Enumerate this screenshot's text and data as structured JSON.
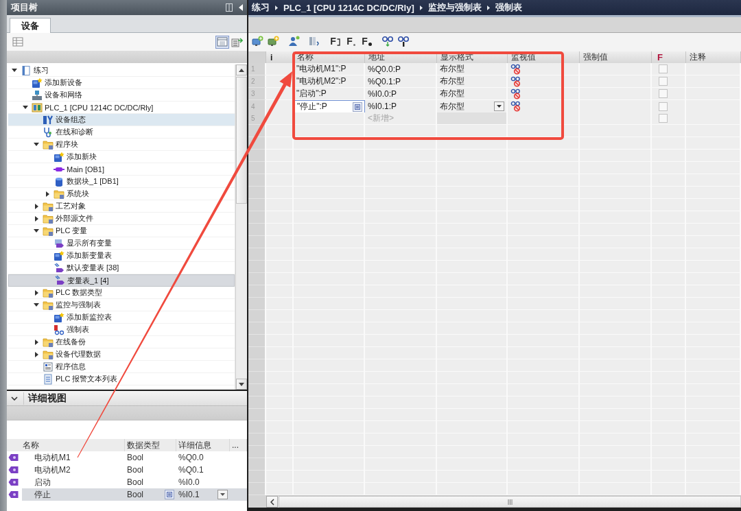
{
  "project_tree": {
    "title": "项目树",
    "tabs": [
      {
        "label": "设备",
        "selected": true
      }
    ],
    "items": [
      {
        "label": "练习",
        "kind": "project",
        "expanded": true,
        "selected": false,
        "highlighted": false,
        "children": [
          {
            "label": "添加新设备",
            "kind": "add",
            "selected": false,
            "highlighted": false
          },
          {
            "label": "设备和网络",
            "kind": "network",
            "selected": false,
            "highlighted": false
          },
          {
            "label": "PLC_1 [CPU 1214C DC/DC/Rly]",
            "kind": "plc",
            "expanded": true,
            "selected": false,
            "highlighted": false,
            "children": [
              {
                "label": "设备组态",
                "kind": "config",
                "selected": false,
                "highlighted": true
              },
              {
                "label": "在线和诊断",
                "kind": "diag",
                "selected": false,
                "highlighted": false
              },
              {
                "label": "程序块",
                "kind": "folder",
                "expanded": true,
                "selected": false,
                "highlighted": false,
                "children": [
                  {
                    "label": "添加新块",
                    "kind": "add",
                    "selected": false,
                    "highlighted": false
                  },
                  {
                    "label": "Main [OB1]",
                    "kind": "ob",
                    "selected": false,
                    "highlighted": false
                  },
                  {
                    "label": "数据块_1 [DB1]",
                    "kind": "db",
                    "selected": false,
                    "highlighted": false
                  },
                  {
                    "label": "系统块",
                    "kind": "folder",
                    "expanded": false,
                    "selected": false,
                    "highlighted": false
                  }
                ]
              },
              {
                "label": "工艺对象",
                "kind": "folder",
                "expanded": false,
                "selected": false,
                "highlighted": false
              },
              {
                "label": "外部源文件",
                "kind": "folder",
                "expanded": false,
                "selected": false,
                "highlighted": false
              },
              {
                "label": "PLC 变量",
                "kind": "folder",
                "expanded": true,
                "selected": false,
                "highlighted": false,
                "children": [
                  {
                    "label": "显示所有变量",
                    "kind": "alltags",
                    "selected": false,
                    "highlighted": false
                  },
                  {
                    "label": "添加新变量表",
                    "kind": "add",
                    "selected": false,
                    "highlighted": false
                  },
                  {
                    "label": "默认变量表 [38]",
                    "kind": "tagtable",
                    "selected": false,
                    "highlighted": false
                  },
                  {
                    "label": "变量表_1 [4]",
                    "kind": "tagtable",
                    "selected": true,
                    "highlighted": false
                  }
                ]
              },
              {
                "label": "PLC 数据类型",
                "kind": "folder",
                "expanded": false,
                "selected": false,
                "highlighted": false
              },
              {
                "label": "监控与强制表",
                "kind": "folder",
                "expanded": true,
                "selected": false,
                "highlighted": false,
                "children": [
                  {
                    "label": "添加新监控表",
                    "kind": "add",
                    "selected": false,
                    "highlighted": false
                  },
                  {
                    "label": "强制表",
                    "kind": "forcetable",
                    "selected": false,
                    "highlighted": false
                  }
                ]
              },
              {
                "label": "在线备份",
                "kind": "folder",
                "expanded": false,
                "selected": false,
                "highlighted": false
              },
              {
                "label": "设备代理数据",
                "kind": "folder",
                "expanded": false,
                "selected": false,
                "highlighted": false
              },
              {
                "label": "程序信息",
                "kind": "info",
                "selected": false,
                "highlighted": false
              },
              {
                "label": "PLC 报警文本列表",
                "kind": "textlist",
                "selected": false,
                "highlighted": false
              }
            ]
          }
        ]
      }
    ]
  },
  "details_view": {
    "title": "详细视图",
    "expanded": true,
    "columns": [
      "名称",
      "数据类型",
      "详细信息",
      "..."
    ],
    "rows": [
      {
        "name": "电动机M1",
        "data_type": "Bool",
        "detail": "%Q0.0",
        "selected": false
      },
      {
        "name": "电动机M2",
        "data_type": "Bool",
        "detail": "%Q0.1",
        "selected": false
      },
      {
        "name": "启动",
        "data_type": "Bool",
        "detail": "%I0.0",
        "selected": false
      },
      {
        "name": "停止",
        "data_type": "Bool",
        "detail": "%I0.1",
        "selected": true
      }
    ]
  },
  "editor": {
    "breadcrumb": [
      "练习",
      "PLC_1 [CPU 1214C DC/DC/Rly]",
      "监控与强制表",
      "强制表"
    ],
    "toolbar": [
      {
        "kind": "insert"
      },
      {
        "kind": "append"
      },
      {
        "kind": "users"
      },
      {
        "kind": "sheet"
      },
      {
        "kind": "forceall",
        "text": "F"
      },
      {
        "kind": "forcestop",
        "text": "F"
      },
      {
        "kind": "forceone",
        "text": "F"
      },
      {
        "kind": "monitorall"
      },
      {
        "kind": "monitorone"
      }
    ],
    "columns": [
      {
        "label": "i",
        "kind": "status"
      },
      {
        "label": "名称",
        "kind": "text"
      },
      {
        "label": "地址",
        "kind": "text"
      },
      {
        "label": "显示格式",
        "kind": "text"
      },
      {
        "label": "监视值",
        "kind": "text"
      },
      {
        "label": "强制值",
        "kind": "text"
      },
      {
        "label": "F",
        "kind": "flag"
      },
      {
        "label": "注释",
        "kind": "text"
      }
    ],
    "rows": [
      {
        "number": "1",
        "kind": "entry",
        "name": "\"电动机M1\":P",
        "address": "%Q0.0:P",
        "display_format": "布尔型",
        "monitor_offline": true,
        "force_enabled": false,
        "editing": false
      },
      {
        "number": "2",
        "kind": "entry",
        "name": "\"电动机M2\":P",
        "address": "%Q0.1:P",
        "display_format": "布尔型",
        "monitor_offline": true,
        "force_enabled": false,
        "editing": false
      },
      {
        "number": "3",
        "kind": "entry",
        "name": "\"启动\":P",
        "address": "%I0.0:P",
        "display_format": "布尔型",
        "monitor_offline": true,
        "force_enabled": false,
        "editing": false
      },
      {
        "number": "4",
        "kind": "entry",
        "name": "\"停止\":P",
        "address": "%I0.1:P",
        "display_format": "布尔型",
        "monitor_offline": true,
        "force_enabled": false,
        "editing": true
      },
      {
        "number": "5",
        "kind": "new",
        "address": "<新增>",
        "monitor_offline": false,
        "force_enabled": false,
        "editing": false
      }
    ]
  },
  "annotations": {
    "frame": true,
    "arrow": true
  }
}
